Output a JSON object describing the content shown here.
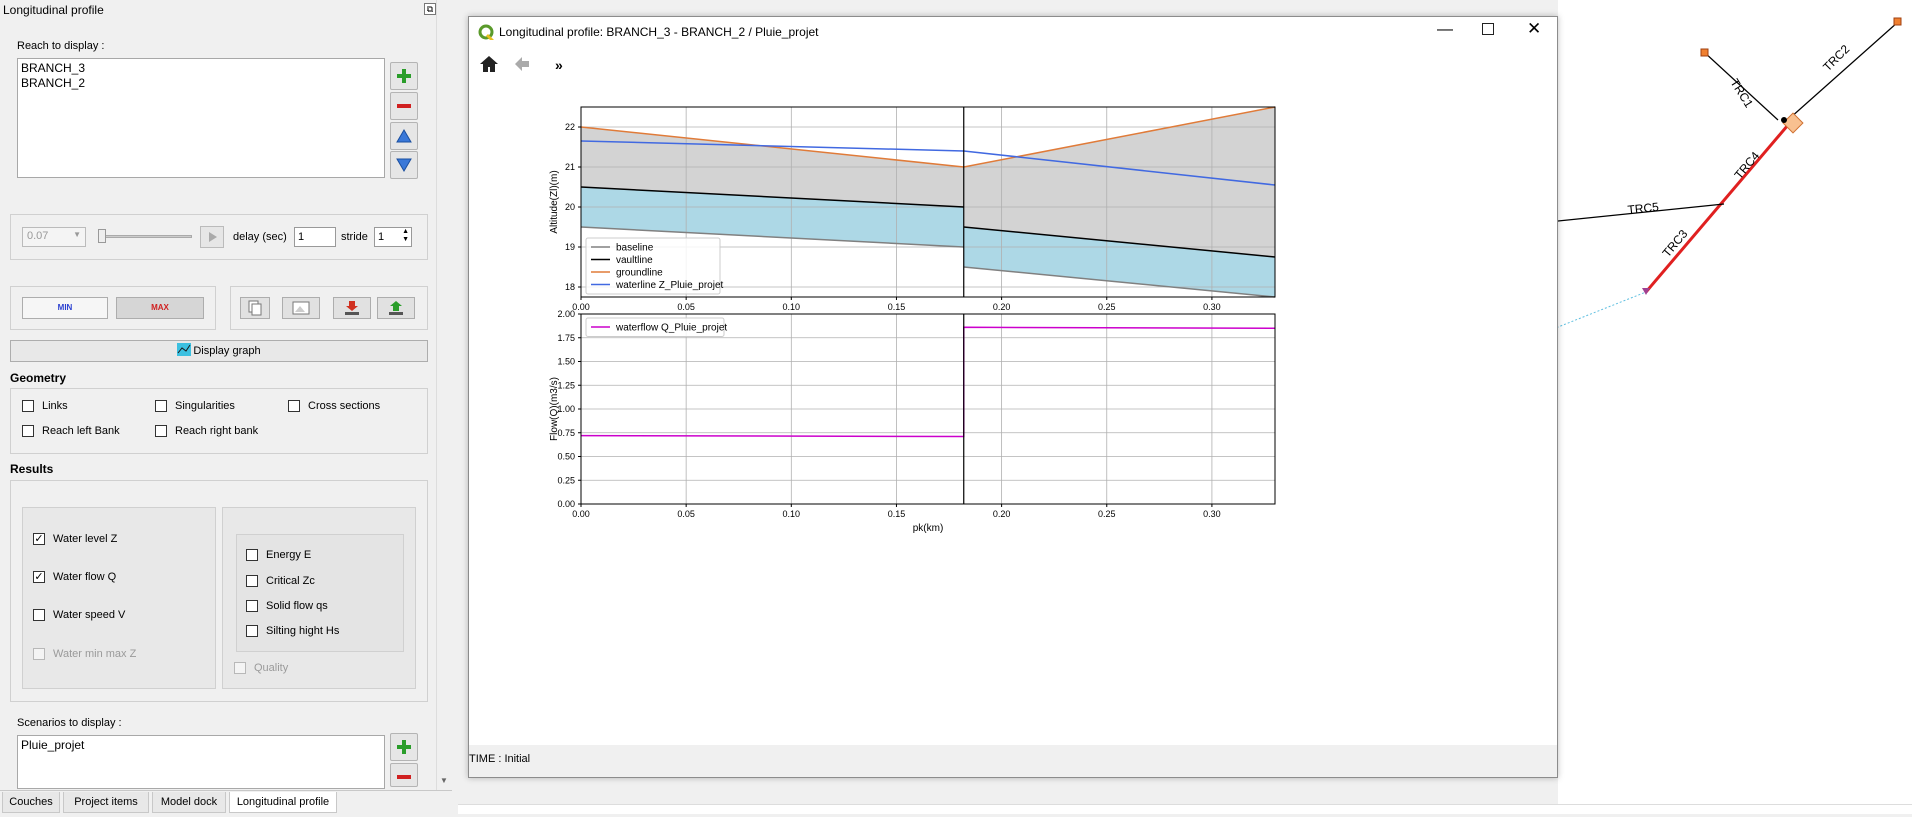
{
  "dock": {
    "title": "Longitudinal profile",
    "reach_label": "Reach to display :",
    "reaches": [
      "BRANCH_3",
      "BRANCH_2"
    ],
    "time_value": "0.07",
    "delay_label": "delay (sec)",
    "delay_value": "1",
    "stride_label": "stride",
    "stride_value": "1",
    "min_label": "MIN",
    "max_label": "MAX",
    "display_graph": "Display graph",
    "geometry_title": "Geometry",
    "geometry": {
      "links": "Links",
      "singularities": "Singularities",
      "cross_sections": "Cross sections",
      "reach_left": "Reach left Bank",
      "reach_right": "Reach right bank"
    },
    "results_title": "Results",
    "results": {
      "water_level": "Water level Z",
      "water_flow": "Water flow Q",
      "water_speed": "Water speed V",
      "water_minmax": "Water min max Z",
      "energy": "Energy E",
      "critical": "Critical Zc",
      "solid_flow": "Solid flow qs",
      "silting": "Silting hight Hs",
      "quality": "Quality"
    },
    "scenarios_label": "Scenarios to display :",
    "scenarios": [
      "Pluie_projet"
    ],
    "tabs": [
      "Couches",
      "Project items",
      "Model dock",
      "Longitudinal profile"
    ]
  },
  "window": {
    "title": "Longitudinal profile: BRANCH_3 - BRANCH_2  / Pluie_projet",
    "status": "TIME : Initial"
  },
  "map": {
    "labels": [
      "TRC1",
      "TRC2",
      "TRC4",
      "TRC5",
      "TRC3"
    ]
  },
  "chart_data": [
    {
      "type": "line",
      "ylabel": "Altitude(Zl)(m)",
      "xlim": [
        0.0,
        0.33
      ],
      "ylim": [
        17.75,
        22.5
      ],
      "xticks": [
        "0.00",
        "0.05",
        "0.10",
        "0.15",
        "0.20",
        "0.25",
        "0.30"
      ],
      "yticks": [
        "18",
        "19",
        "20",
        "21",
        "22"
      ],
      "grid": true,
      "legend_position": "lower-left",
      "series": [
        {
          "name": "baseline",
          "color": "#808080",
          "segments": [
            [
              [
                0.0,
                19.5
              ],
              [
                0.182,
                19.0
              ]
            ],
            [
              [
                0.182,
                18.5
              ],
              [
                0.33,
                17.75
              ]
            ]
          ]
        },
        {
          "name": "vaultline",
          "color": "#000000",
          "segments": [
            [
              [
                0.0,
                20.5
              ],
              [
                0.182,
                20.0
              ]
            ],
            [
              [
                0.182,
                19.5
              ],
              [
                0.33,
                18.75
              ]
            ]
          ]
        },
        {
          "name": "groundline",
          "color": "#e07b39",
          "segments": [
            [
              [
                0.0,
                22.0
              ],
              [
                0.182,
                21.0
              ],
              [
                0.33,
                22.5
              ]
            ]
          ]
        },
        {
          "name": "waterline Z_Pluie_projet",
          "color": "#4169e1",
          "segments": [
            [
              [
                0.0,
                21.65
              ],
              [
                0.182,
                21.4
              ],
              [
                0.33,
                20.55
              ]
            ]
          ]
        }
      ],
      "vline_x": 0.182
    },
    {
      "type": "line",
      "xlabel": "pk(km)",
      "ylabel": "Flow(Q)(m3/s)",
      "xlim": [
        0.0,
        0.33
      ],
      "ylim": [
        0.0,
        2.0
      ],
      "xticks": [
        "0.00",
        "0.05",
        "0.10",
        "0.15",
        "0.20",
        "0.25",
        "0.30"
      ],
      "yticks": [
        "0.00",
        "0.25",
        "0.50",
        "0.75",
        "1.00",
        "1.25",
        "1.50",
        "1.75",
        "2.00"
      ],
      "grid": true,
      "legend_position": "top-left",
      "series": [
        {
          "name": "waterflow Q_Pluie_projet",
          "color": "#cc00cc",
          "segments": [
            [
              [
                0.0,
                0.72
              ],
              [
                0.182,
                0.71
              ],
              [
                0.182,
                1.86
              ],
              [
                0.33,
                1.85
              ]
            ]
          ]
        }
      ],
      "vline_x": 0.182
    }
  ]
}
